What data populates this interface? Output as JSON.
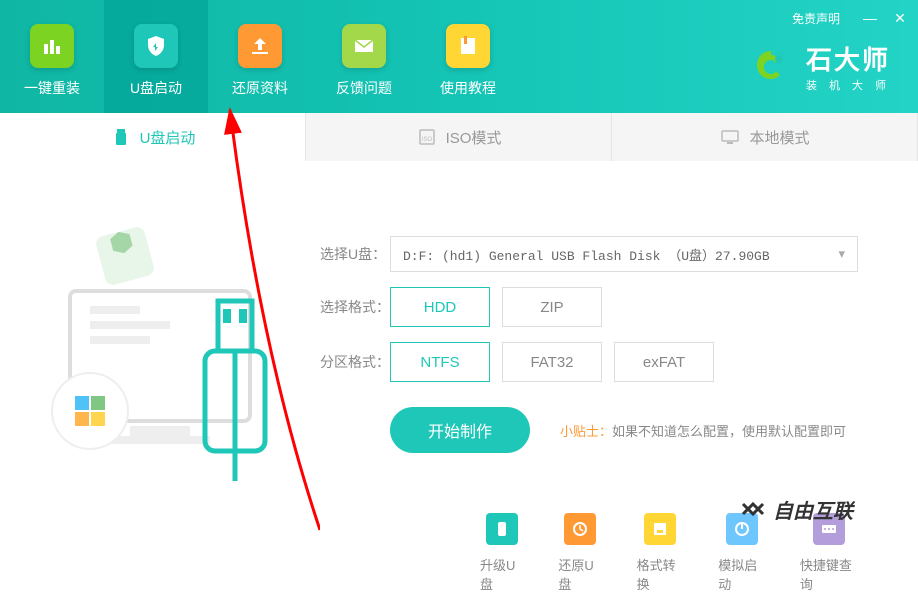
{
  "disclaimer": "免责声明",
  "nav": [
    {
      "label": "一键重装",
      "icon": "chart"
    },
    {
      "label": "U盘启动",
      "icon": "shield"
    },
    {
      "label": "还原资料",
      "icon": "upload"
    },
    {
      "label": "反馈问题",
      "icon": "envelope"
    },
    {
      "label": "使用教程",
      "icon": "book"
    }
  ],
  "brand": {
    "name": "石大师",
    "subtitle": "装机大师"
  },
  "sub_tabs": [
    {
      "label": "U盘启动"
    },
    {
      "label": "ISO模式"
    },
    {
      "label": "本地模式"
    }
  ],
  "form": {
    "usb_label": "选择U盘：",
    "usb_value": "D:F: (hd1) General USB Flash Disk （U盘）27.90GB",
    "format_label": "选择格式：",
    "format_options": [
      "HDD",
      "ZIP"
    ],
    "partition_label": "分区格式：",
    "partition_options": [
      "NTFS",
      "FAT32",
      "exFAT"
    ]
  },
  "action": {
    "start_button": "开始制作",
    "tip_label": "小贴士：",
    "tip_text": "如果不知道怎么配置，使用默认配置即可"
  },
  "tools": [
    {
      "label": "升级U盘",
      "color": "#1fc7b8"
    },
    {
      "label": "还原U盘",
      "color": "#ff9933"
    },
    {
      "label": "格式转换",
      "color": "#ffd633"
    },
    {
      "label": "模拟启动",
      "color": "#6ec6ff"
    },
    {
      "label": "快捷键查询",
      "color": "#b39ddb"
    }
  ],
  "watermark": "自由互联"
}
